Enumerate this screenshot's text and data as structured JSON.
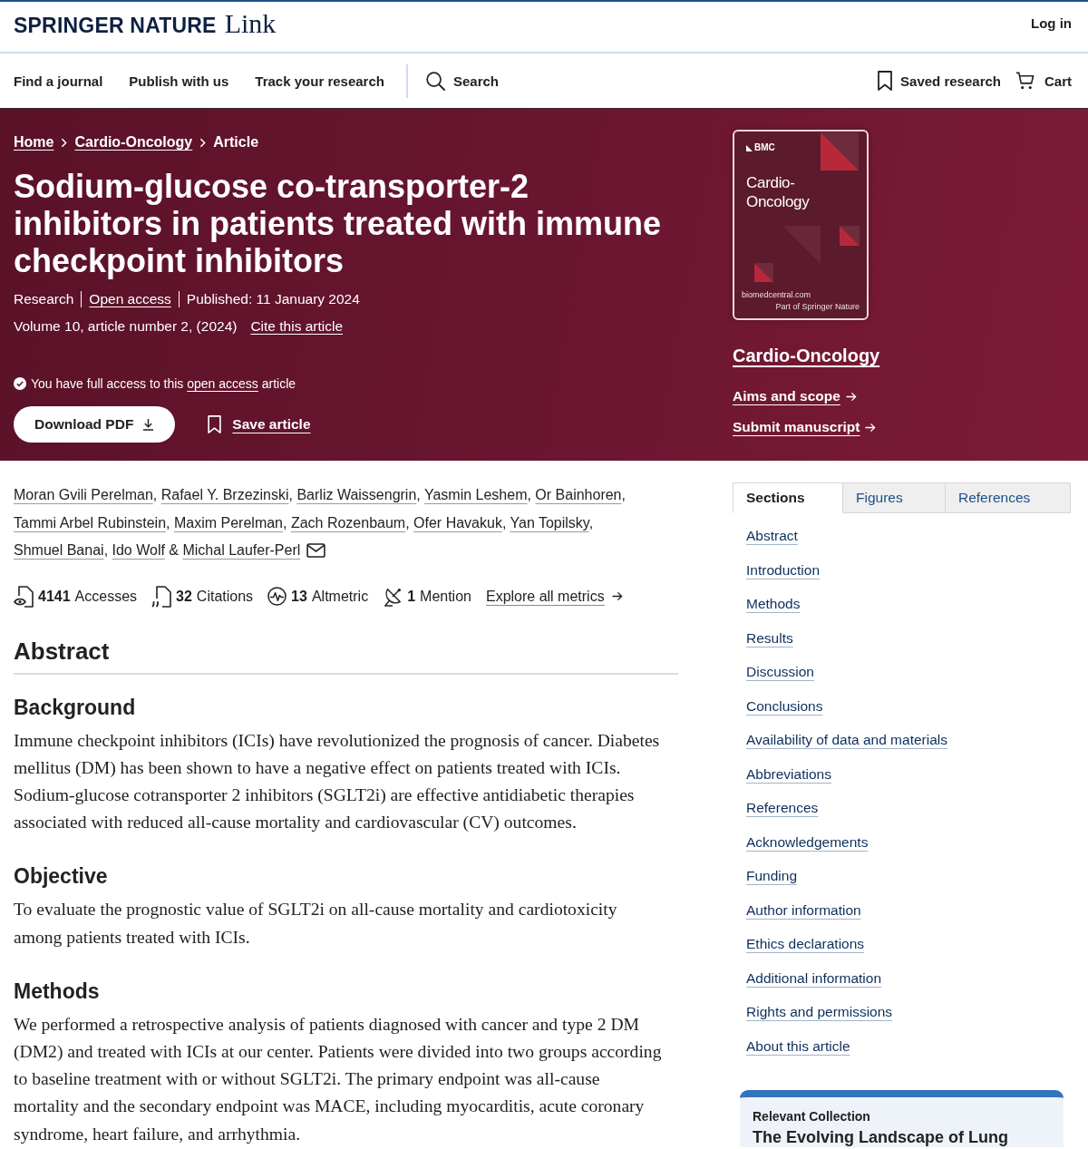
{
  "header": {
    "logo": {
      "brand": "SPRINGER NATURE",
      "product": "Link"
    },
    "login": "Log in"
  },
  "nav": {
    "links": [
      "Find a journal",
      "Publish with us",
      "Track your research"
    ],
    "search": "Search",
    "saved": "Saved research",
    "cart": "Cart"
  },
  "hero": {
    "breadcrumbs": [
      {
        "label": "Home",
        "kind": "link"
      },
      {
        "label": "Cardio-Oncology",
        "kind": "link"
      },
      {
        "label": "Article",
        "kind": "current"
      }
    ],
    "title": "Sodium-glucose co-transporter-2 inhibitors in patients treated with immune checkpoint inhibitors",
    "meta": [
      {
        "label": "Research",
        "kind": "text"
      },
      {
        "label": "Open access",
        "kind": "link"
      },
      {
        "label": "Published: 11 January 2024",
        "kind": "text"
      }
    ],
    "citation": "Volume 10, article number 2, (2024)",
    "cite_link": "Cite this article",
    "access_notice": {
      "before": "You have full access to this",
      "link": "open access",
      "after": "article"
    },
    "download_button": "Download PDF",
    "save_button": "Save article"
  },
  "journal": {
    "cover": {
      "publisher": "BMC",
      "title": "Cardio-Oncology",
      "footer_left": "biomedcentral.com",
      "footer_right": "Part of Springer Nature"
    },
    "name": "Cardio-Oncology",
    "links": [
      "Aims and scope",
      "Submit manuscript"
    ]
  },
  "authors": {
    "separator": ",",
    "final_separator": "&",
    "list": [
      {
        "name": "Moran Gvili Perelman",
        "corresponding": false
      },
      {
        "name": "Rafael Y. Brzezinski",
        "corresponding": false
      },
      {
        "name": "Barliz Waissengrin",
        "corresponding": false
      },
      {
        "name": "Yasmin Leshem",
        "corresponding": false
      },
      {
        "name": "Or Bainhoren",
        "corresponding": false
      },
      {
        "name": "Tammi Arbel Rubinstein",
        "corresponding": false
      },
      {
        "name": "Maxim Perelman",
        "corresponding": false
      },
      {
        "name": "Zach Rozenbaum",
        "corresponding": false
      },
      {
        "name": "Ofer Havakuk",
        "corresponding": false
      },
      {
        "name": "Yan Topilsky",
        "corresponding": false
      },
      {
        "name": "Shmuel Banai",
        "corresponding": false
      },
      {
        "name": "Ido Wolf",
        "corresponding": false
      },
      {
        "name": "Michal Laufer-Perl",
        "corresponding": true
      }
    ]
  },
  "metrics": {
    "items": [
      {
        "kind": "accesses",
        "value": "4141",
        "label": "Accesses"
      },
      {
        "kind": "citations",
        "value": "32",
        "label": "Citations"
      },
      {
        "kind": "altmetric",
        "value": "13",
        "label": "Altmetric"
      },
      {
        "kind": "mention",
        "value": "1",
        "label": "Mention"
      }
    ],
    "link": "Explore all metrics"
  },
  "abstract": {
    "heading": "Abstract",
    "sections": [
      {
        "heading": "Background",
        "text": "Immune checkpoint inhibitors (ICIs) have revolutionized the prognosis of cancer. Diabetes mellitus (DM) has been shown to have a negative effect on patients treated with ICIs. Sodium-glucose cotransporter 2 inhibitors (SGLT2i) are effective antidiabetic therapies associated with reduced all-cause mortality and cardiovascular (CV) outcomes."
      },
      {
        "heading": "Objective",
        "text": "To evaluate the prognostic value of SGLT2i on all-cause mortality and cardiotoxicity among patients treated with ICIs."
      },
      {
        "heading": "Methods",
        "text": "We performed a retrospective analysis of patients diagnosed with cancer and type 2 DM (DM2) and treated with ICIs at our center. Patients were divided into two groups according to baseline treatment with or without SGLT2i. The primary endpoint was all-cause mortality and the secondary endpoint was MACE, including myocarditis, acute coronary syndrome, heart failure, and arrhythmia."
      }
    ]
  },
  "sidebar": {
    "tabs": [
      {
        "label": "Sections",
        "selected": true
      },
      {
        "label": "Figures",
        "selected": false
      },
      {
        "label": "References",
        "selected": false
      }
    ],
    "sections": [
      "Abstract",
      "Introduction",
      "Methods",
      "Results",
      "Discussion",
      "Conclusions",
      "Availability of data and materials",
      "Abbreviations",
      "References",
      "Acknowledgements",
      "Funding",
      "Author information",
      "Ethics declarations",
      "Additional information",
      "Rights and permissions",
      "About this article"
    ],
    "collection": {
      "label": "Relevant Collection",
      "title": "The Evolving Landscape of Lung"
    }
  }
}
